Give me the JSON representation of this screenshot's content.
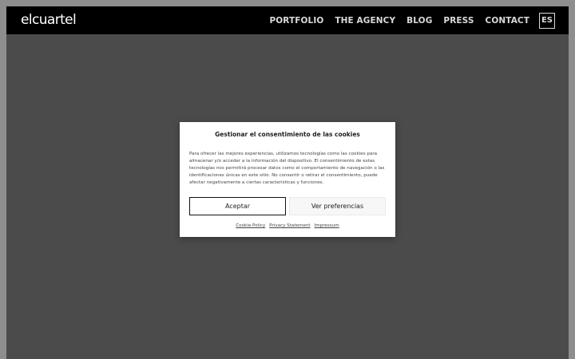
{
  "header": {
    "logo": "elcuartel",
    "nav": [
      {
        "label": "PORTFOLIO"
      },
      {
        "label": "THE AGENCY"
      },
      {
        "label": "BLOG"
      },
      {
        "label": "PRESS"
      },
      {
        "label": "CONTACT"
      }
    ],
    "language": "ES"
  },
  "cookie_modal": {
    "title": "Gestionar el consentimiento de las cookies",
    "body": "Para ofrecer las mejores experiencias, utilizamos tecnologías como las cookies para almacenar y/o acceder a la información del dispositivo. El consentimiento de estas tecnologías nos permitirá procesar datos como el comportamiento de navegación o las identificaciones únicas en este sitio. No consentir o retirar el consentimiento, puede afectar negativamente a ciertas características y funciones.",
    "accept_label": "Aceptar",
    "preferences_label": "Ver preferencias",
    "links": [
      {
        "label": "Cookie Policy"
      },
      {
        "label": "Privacy Statement"
      },
      {
        "label": "Impressum"
      }
    ]
  }
}
